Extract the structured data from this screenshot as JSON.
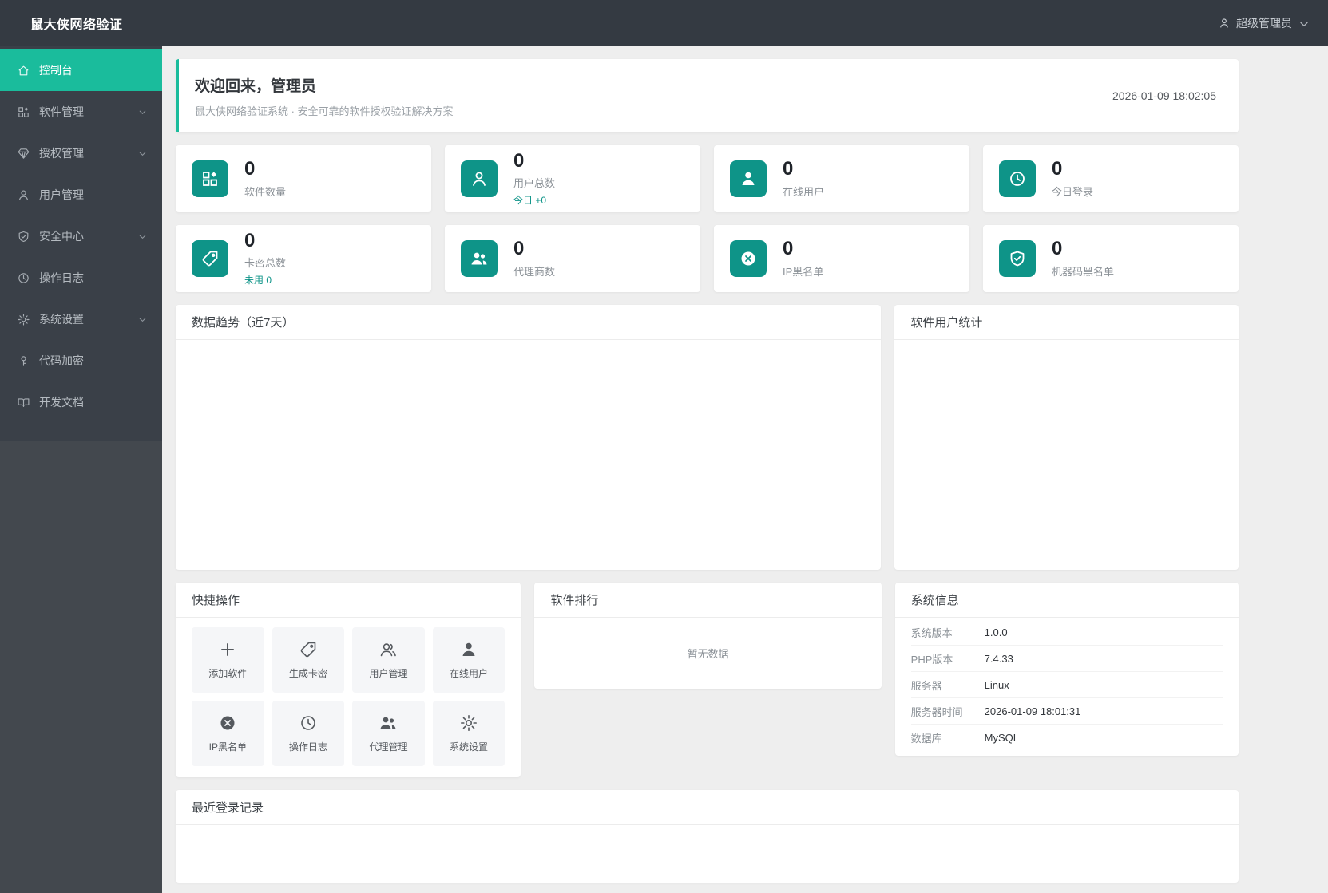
{
  "colors": {
    "accent": "#1abc9c",
    "icon_teal": "#0e9488",
    "header_bg": "#343a42"
  },
  "header": {
    "app_title": "鼠大侠网络验证",
    "user_name": "超级管理员",
    "user_icon": "person-icon",
    "dropdown_icon": "chevron-down-icon"
  },
  "sidebar": {
    "items": [
      {
        "label": "控制台",
        "icon": "home-icon",
        "active": true,
        "expandable": false
      },
      {
        "label": "软件管理",
        "icon": "apps-icon",
        "active": false,
        "expandable": true
      },
      {
        "label": "授权管理",
        "icon": "gem-icon",
        "active": false,
        "expandable": true
      },
      {
        "label": "用户管理",
        "icon": "user-icon",
        "active": false,
        "expandable": false
      },
      {
        "label": "安全中心",
        "icon": "shield-check-icon",
        "active": false,
        "expandable": true
      },
      {
        "label": "操作日志",
        "icon": "clock-icon",
        "active": false,
        "expandable": false
      },
      {
        "label": "系统设置",
        "icon": "gear-icon",
        "active": false,
        "expandable": true
      },
      {
        "label": "代码加密",
        "icon": "key-icon",
        "active": false,
        "expandable": false
      },
      {
        "label": "开发文档",
        "icon": "book-icon",
        "active": false,
        "expandable": false
      }
    ]
  },
  "welcome": {
    "title": "欢迎回来，管理员",
    "subtitle": "鼠大侠网络验证系统 · 安全可靠的软件授权验证解决方案",
    "datetime": "2026-01-09 18:02:05"
  },
  "stats": [
    {
      "value": "0",
      "label": "软件数量",
      "sub": "",
      "icon": "apps-icon"
    },
    {
      "value": "0",
      "label": "用户总数",
      "sub": "今日 +0",
      "icon": "user-outline-icon"
    },
    {
      "value": "0",
      "label": "在线用户",
      "sub": "",
      "icon": "user-filled-icon"
    },
    {
      "value": "0",
      "label": "今日登录",
      "sub": "",
      "icon": "clock-icon"
    },
    {
      "value": "0",
      "label": "卡密总数",
      "sub": "未用 0",
      "icon": "tag-icon"
    },
    {
      "value": "0",
      "label": "代理商数",
      "sub": "",
      "icon": "users-filled-icon"
    },
    {
      "value": "0",
      "label": "IP黑名单",
      "sub": "",
      "icon": "ban-icon"
    },
    {
      "value": "0",
      "label": "机器码黑名单",
      "sub": "",
      "icon": "shield-check-icon"
    }
  ],
  "panels": {
    "trend_title": "数据趋势（近7天）",
    "user_stats_title": "软件用户统计",
    "quick_title": "快捷操作",
    "ranking_title": "软件排行",
    "ranking_empty": "暂无数据",
    "sysinfo_title": "系统信息",
    "recent_title": "最近登录记录"
  },
  "quick_actions": [
    {
      "label": "添加软件",
      "icon": "plus-icon"
    },
    {
      "label": "生成卡密",
      "icon": "tag-icon"
    },
    {
      "label": "用户管理",
      "icon": "users-outline-icon"
    },
    {
      "label": "在线用户",
      "icon": "user-filled-icon"
    },
    {
      "label": "IP黑名单",
      "icon": "ban-icon"
    },
    {
      "label": "操作日志",
      "icon": "clock-icon"
    },
    {
      "label": "代理管理",
      "icon": "users-filled-icon"
    },
    {
      "label": "系统设置",
      "icon": "gear-icon"
    }
  ],
  "system_info": [
    {
      "label": "系统版本",
      "value": "1.0.0"
    },
    {
      "label": "PHP版本",
      "value": "7.4.33"
    },
    {
      "label": "服务器",
      "value": "Linux"
    },
    {
      "label": "服务器时间",
      "value": "2026-01-09 18:01:31"
    },
    {
      "label": "数据库",
      "value": "MySQL"
    }
  ]
}
